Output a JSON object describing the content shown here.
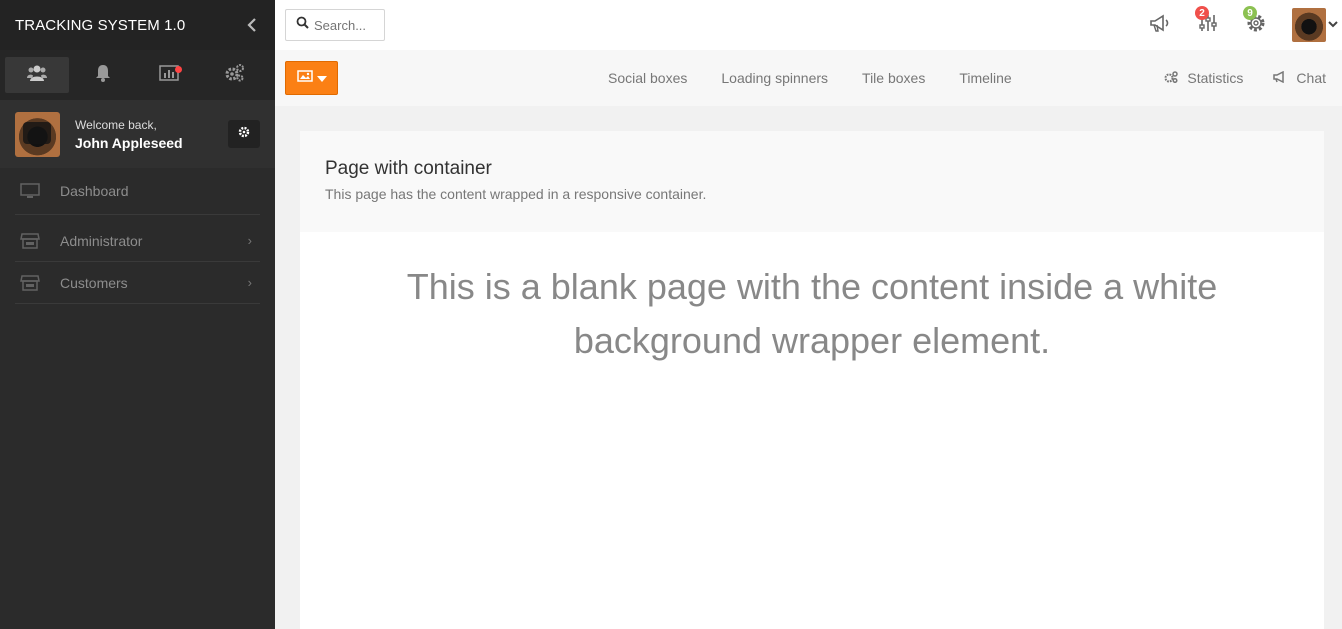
{
  "app": {
    "title": "TRACKING SYSTEM 1.0"
  },
  "sidebar": {
    "tabs": [
      {
        "icon": "users-icon",
        "active": true
      },
      {
        "icon": "bell-icon"
      },
      {
        "icon": "bar-chart-icon",
        "has_dot": true
      },
      {
        "icon": "cogs-icon"
      }
    ],
    "profile": {
      "welcome": "Welcome back,",
      "name": "John Appleseed"
    },
    "menu": [
      {
        "label": "Dashboard",
        "icon": "monitor-icon"
      },
      {
        "label": "Administrator",
        "icon": "store-icon",
        "has_children": true
      },
      {
        "label": "Customers",
        "icon": "store-icon",
        "has_children": true
      }
    ]
  },
  "topbar": {
    "search": {
      "placeholder": "Search..."
    },
    "badges": {
      "settings_sliders": "2",
      "gear": "9"
    }
  },
  "subnav": {
    "links": [
      "Social boxes",
      "Loading spinners",
      "Tile boxes",
      "Timeline"
    ],
    "statistics": "Statistics",
    "chat": "Chat"
  },
  "content": {
    "title": "Page with container",
    "subtitle": "This page has the content wrapped in a responsive container.",
    "body": "This is a blank page with the content inside a white background wrapper element."
  },
  "colors": {
    "accent": "#fb8014",
    "sidebar": "#2b2b2b",
    "badge_red": "#f0504b",
    "badge_green": "#8cc152"
  }
}
